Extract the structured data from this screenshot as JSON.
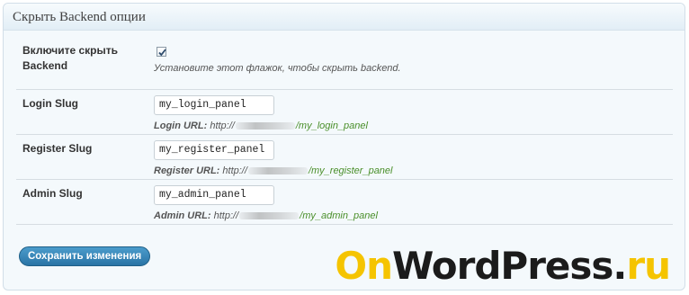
{
  "panel": {
    "title": "Скрыть Backend опции"
  },
  "hide_backend": {
    "label_line1": "Включите скрыть",
    "label_line2": "Backend",
    "checked": true,
    "description": "Установите этот флажок, чтобы скрыть backend."
  },
  "login": {
    "label": "Login Slug",
    "value": "my_login_panel",
    "url_label": "Login URL:",
    "url_prefix": "http://",
    "url_slug": "/my_login_panel"
  },
  "register": {
    "label": "Register Slug",
    "value": "my_register_panel",
    "url_label": "Register URL:",
    "url_prefix": "http://",
    "url_slug": "/my_register_panel"
  },
  "admin": {
    "label": "Admin Slug",
    "value": "my_admin_panel",
    "url_label": "Admin URL:",
    "url_prefix": "http://",
    "url_slug": "/my_admin_panel"
  },
  "save_button": {
    "label": "Сохранить изменения"
  },
  "watermark": {
    "part1": "On",
    "part2": "WordPress.",
    "part3": "ru"
  },
  "colors": {
    "accent_button": "#2a74a5",
    "slug_green": "#4a8f2a",
    "watermark_yellow": "#f5c400"
  },
  "icons": {
    "checkbox": "checkmark-icon"
  }
}
